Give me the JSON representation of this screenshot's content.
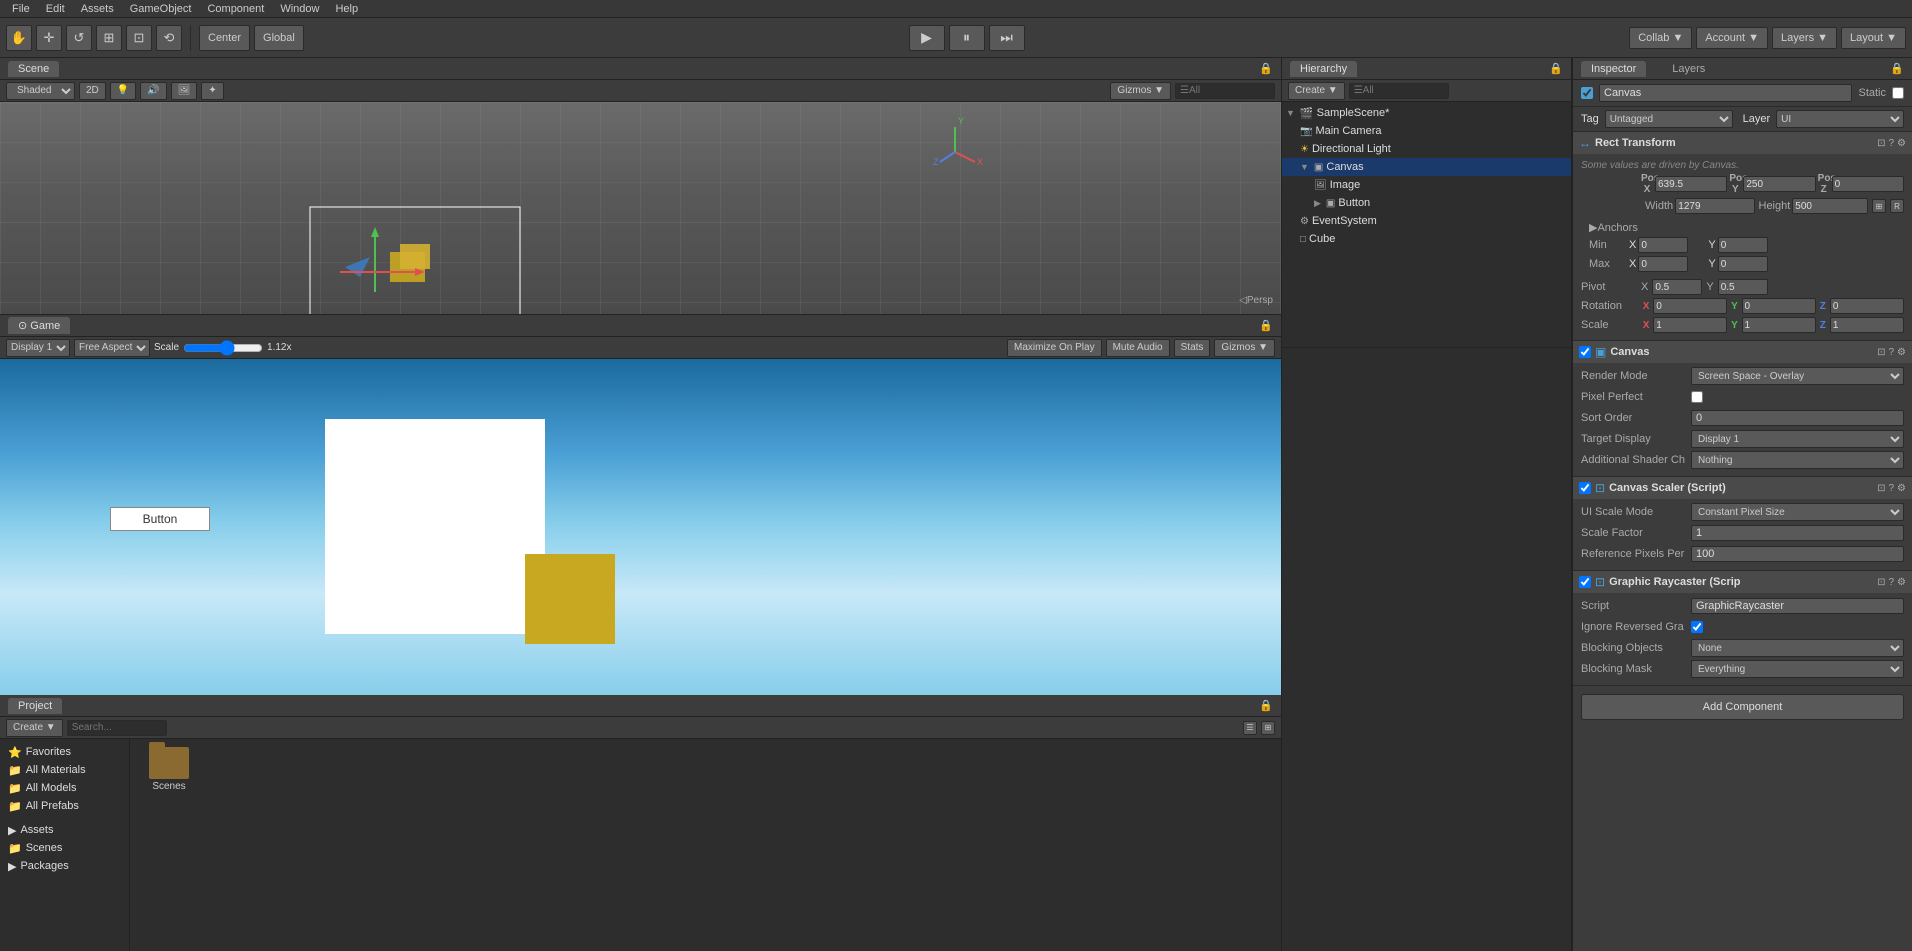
{
  "menubar": {
    "items": [
      "File",
      "Edit",
      "Assets",
      "GameObject",
      "Component",
      "Window",
      "Help"
    ]
  },
  "toolbar": {
    "transform_tools": [
      "⬡",
      "✛",
      "↺",
      "⊞",
      "⊡",
      "⟲"
    ],
    "pivot_label": "Center",
    "space_label": "Global",
    "play_btn": "▶",
    "pause_btn": "⏸",
    "step_btn": "⏭",
    "collab_label": "Collab ▼",
    "account_label": "Account ▼",
    "layers_label": "Layers ▼",
    "layout_label": "Layout ▼"
  },
  "scene": {
    "tab_label": "Scene",
    "shaded_label": "Shaded",
    "twod_label": "2D",
    "gizmos_label": "Gizmos ▼",
    "all_label": "☰All",
    "persp_label": "◁Persp"
  },
  "game": {
    "tab_label": "Game",
    "display_label": "Display 1",
    "aspect_label": "Free Aspect",
    "scale_label": "Scale",
    "scale_value": "1.12x",
    "maximize_label": "Maximize On Play",
    "mute_label": "Mute Audio",
    "stats_label": "Stats",
    "gizmos_label": "Gizmos ▼",
    "button_label": "Button"
  },
  "hierarchy": {
    "tab_label": "Hierarchy",
    "create_label": "Create ▼",
    "all_label": "☰All",
    "scene_name": "SampleScene*",
    "items": [
      {
        "name": "Main Camera",
        "indent": 1,
        "icon": "📷",
        "type": "camera"
      },
      {
        "name": "Directional Light",
        "indent": 1,
        "icon": "☀",
        "type": "light"
      },
      {
        "name": "Canvas",
        "indent": 1,
        "icon": "▣",
        "type": "canvas",
        "selected": true,
        "expanded": true
      },
      {
        "name": "Image",
        "indent": 2,
        "icon": "▣",
        "type": "image"
      },
      {
        "name": "Button",
        "indent": 2,
        "icon": "▶",
        "type": "button",
        "hasArrow": true
      },
      {
        "name": "EventSystem",
        "indent": 1,
        "icon": "⚙",
        "type": "event"
      },
      {
        "name": "Cube",
        "indent": 1,
        "icon": "□",
        "type": "cube"
      }
    ]
  },
  "project": {
    "tab_label": "Project",
    "create_label": "Create ▼",
    "favorites": {
      "label": "Favorites",
      "items": [
        "All Materials",
        "All Models",
        "All Prefabs"
      ]
    },
    "assets": {
      "label": "Assets",
      "items": [
        "Scenes"
      ]
    },
    "assets_folder": {
      "label": "Assets",
      "subfolders": [
        "Scenes",
        "Packages"
      ]
    },
    "folders": [
      "Scenes"
    ]
  },
  "inspector": {
    "tab_label": "Inspector",
    "layers_label": "Layers",
    "object_name": "Canvas",
    "static_label": "Static",
    "tag_label": "Tag",
    "tag_value": "Untagged",
    "layer_label": "Layer",
    "layer_value": "UI",
    "rect_transform": {
      "title": "Rect Transform",
      "note": "Some values are driven by Canvas.",
      "pos_x": "639.5",
      "pos_y": "250",
      "pos_z": "0",
      "width": "1279",
      "height": "500",
      "anchors": {
        "min_x": "0",
        "min_y": "0",
        "max_x": "0",
        "max_y": "0"
      },
      "pivot_x": "0.5",
      "pivot_y": "0.5",
      "rotation_x": "0",
      "rotation_y": "0",
      "rotation_z": "0",
      "scale_x": "1",
      "scale_y": "1",
      "scale_z": "1"
    },
    "canvas": {
      "title": "Canvas",
      "render_mode_label": "Render Mode",
      "render_mode_value": "Screen Space - Overlay",
      "pixel_perfect_label": "Pixel Perfect",
      "sort_order_label": "Sort Order",
      "sort_order_value": "0",
      "target_display_label": "Target Display",
      "target_display_value": "Display 1",
      "additional_shader_label": "Additional Shader Ch",
      "additional_shader_value": "Nothing"
    },
    "canvas_scaler": {
      "title": "Canvas Scaler (Script)",
      "ui_scale_label": "UI Scale Mode",
      "ui_scale_value": "Constant Pixel Size",
      "scale_factor_label": "Scale Factor",
      "scale_factor_value": "1",
      "ref_pixels_label": "Reference Pixels Per",
      "ref_pixels_value": "100"
    },
    "graphic_raycaster": {
      "title": "Graphic Raycaster (Scrip",
      "script_label": "Script",
      "script_value": "GraphicRaycaster",
      "ignore_reversed_label": "Ignore Reversed Gra",
      "blocking_objects_label": "Blocking Objects",
      "blocking_objects_value": "None",
      "blocking_mask_label": "Blocking Mask",
      "blocking_mask_value": "Everything"
    },
    "add_component_label": "Add Component"
  }
}
